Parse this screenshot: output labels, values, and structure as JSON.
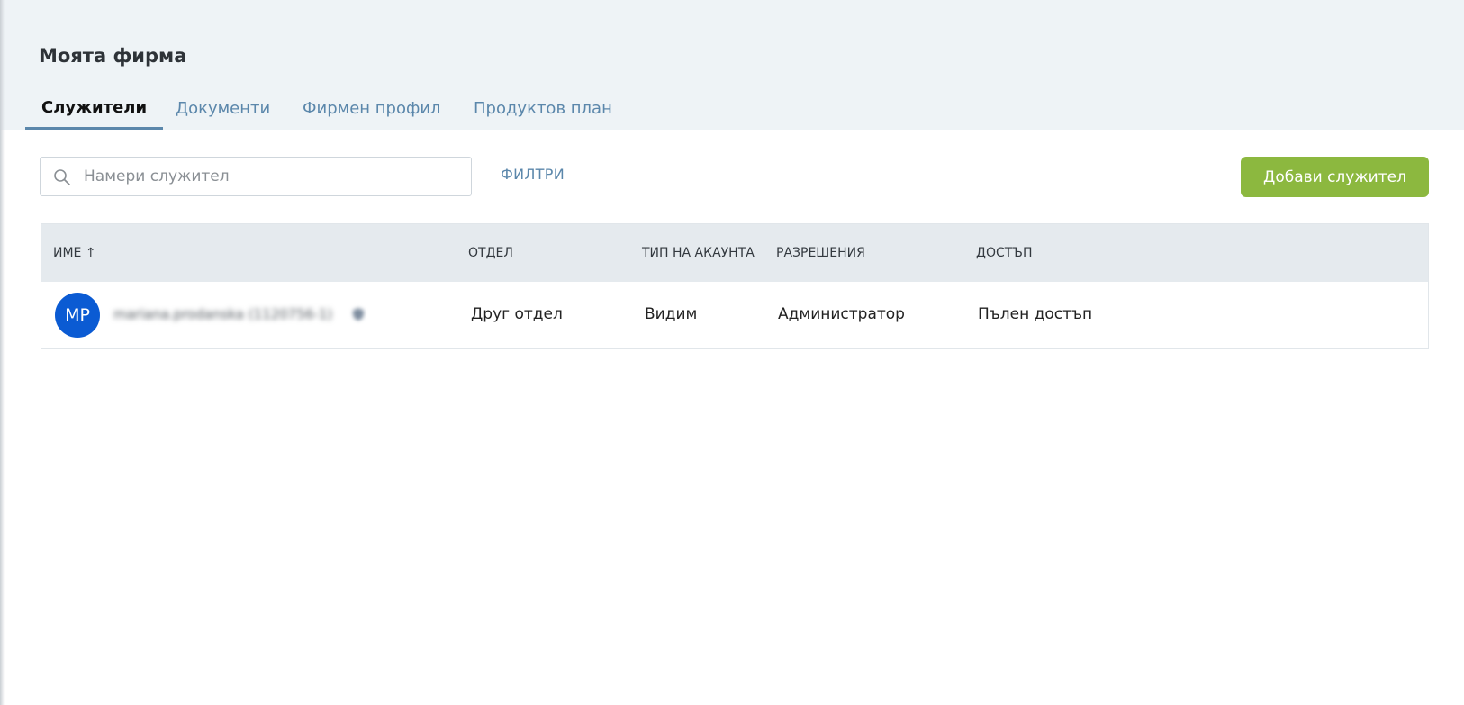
{
  "header": {
    "title": "Моята фирма",
    "tabs": [
      {
        "label": "Служители",
        "active": true
      },
      {
        "label": "Документи",
        "active": false
      },
      {
        "label": "Фирмен профил",
        "active": false
      },
      {
        "label": "Продуктов план",
        "active": false
      }
    ]
  },
  "toolbar": {
    "search_placeholder": "Намери служител",
    "search_value": "",
    "filters_label": "ФИЛТРИ",
    "add_label": "Добави служител"
  },
  "table": {
    "columns": [
      {
        "label": "ИМЕ",
        "sort": "↑"
      },
      {
        "label": "ОТДЕЛ"
      },
      {
        "label": "ТИП НА АКАУНТА"
      },
      {
        "label": "РАЗРЕШЕНИЯ"
      },
      {
        "label": "ДОСТЪП"
      }
    ],
    "rows": [
      {
        "initials": "MP",
        "name": "mariana.prodanska (1120756-1)",
        "department": "Друг отдел",
        "account_type": "Видим",
        "permissions": "Администратор",
        "access": "Пълен достъп"
      }
    ]
  },
  "colors": {
    "header_bg": "#eef3f6",
    "accent": "#5b87ab",
    "button_green": "#8cb83f",
    "avatar_blue": "#0b5bd3",
    "table_head_bg": "#e5eaee"
  }
}
